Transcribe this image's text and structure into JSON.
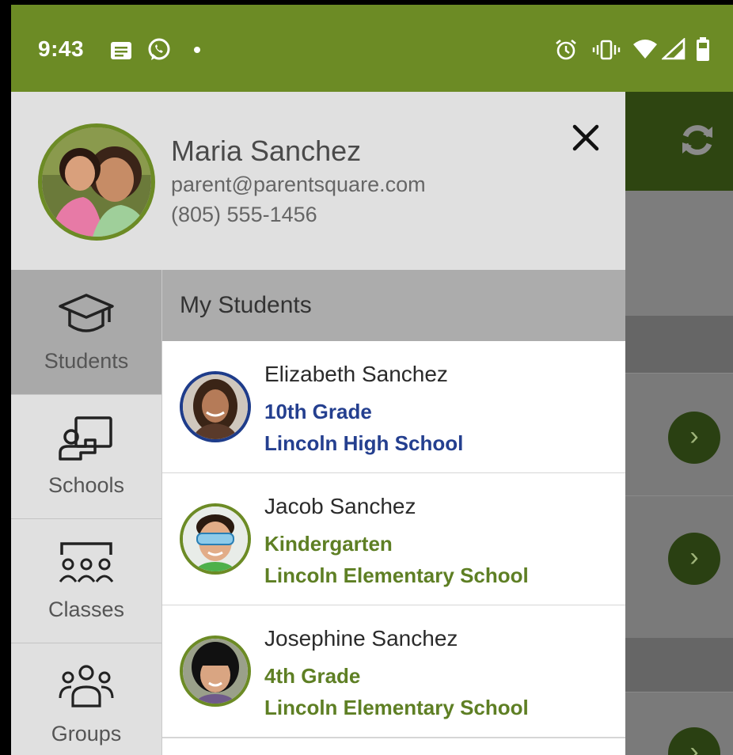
{
  "status_bar": {
    "time": "9:43",
    "left_icons": [
      "message-icon",
      "whatsapp-icon",
      "dot-icon"
    ],
    "right_icons": [
      "alarm-icon",
      "vibrate-icon",
      "wifi-icon",
      "signal-icon",
      "battery-icon"
    ]
  },
  "profile": {
    "name": "Maria Sanchez",
    "email": "parent@parentsquare.com",
    "phone": "(805) 555-1456"
  },
  "sidebar": {
    "items": [
      {
        "label": "Students",
        "icon": "graduation-cap-icon",
        "active": true
      },
      {
        "label": "Schools",
        "icon": "teacher-board-icon",
        "active": false
      },
      {
        "label": "Classes",
        "icon": "classroom-icon",
        "active": false
      },
      {
        "label": "Groups",
        "icon": "group-icon",
        "active": false
      }
    ]
  },
  "students_panel": {
    "title": "My Students",
    "students": [
      {
        "name": "Elizabeth Sanchez",
        "grade": "10th Grade",
        "school": "Lincoln High School",
        "accent": "#243f8f"
      },
      {
        "name": "Jacob Sanchez",
        "grade": "Kindergarten",
        "school": "Lincoln Elementary School",
        "accent": "#5e7f24"
      },
      {
        "name": "Josephine Sanchez",
        "grade": "4th Grade",
        "school": "Lincoln Elementary School",
        "accent": "#5e7f24"
      }
    ]
  },
  "colors": {
    "brand_green": "#6c8b25",
    "dark_green": "#2e4511",
    "high_school_blue": "#243f8f"
  }
}
